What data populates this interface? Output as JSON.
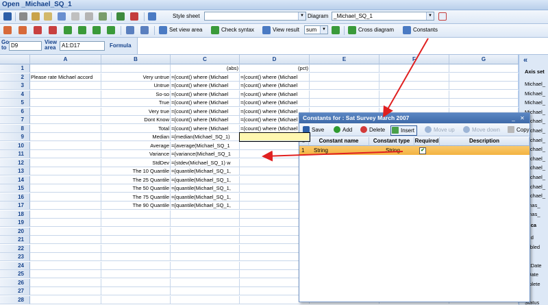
{
  "window": {
    "title": "Open _Michael_SQ_1"
  },
  "toolbar1": {
    "stylesheet_label": "Style sheet",
    "stylesheet_value": "",
    "diagram_label": "Diagram",
    "diagram_value": "_Michael_SQ_1"
  },
  "toolbar2": {
    "set_view_area": "Set view area",
    "check_syntax": "Check syntax",
    "view_result": "View result",
    "agg_value": "sum",
    "cross_diagram": "Cross diagram",
    "constants": "Constants"
  },
  "formula_bar": {
    "goto_label": "Go to",
    "goto_value": "D9",
    "view_area_label": "View area",
    "view_area_value": "A1:D17",
    "formula_label": "Formula"
  },
  "sheet": {
    "columns": [
      "A",
      "B",
      "C",
      "D",
      "E",
      "F",
      "G"
    ],
    "selected_cell": "D9",
    "rows": [
      {
        "n": "1",
        "a": "",
        "b": "",
        "c": "(abs)",
        "d": "(pct)"
      },
      {
        "n": "2",
        "a": "Please rate Michael accord",
        "b": "Very untrue",
        "c": "={count() where (Michael",
        "d": "={count() where (Michael"
      },
      {
        "n": "3",
        "a": "",
        "b": "Untrue",
        "c": "={count() where (Michael",
        "d": "={count() where (Michael"
      },
      {
        "n": "4",
        "a": "",
        "b": "So-so",
        "c": "={count() where (Michael",
        "d": "={count() where (Michael"
      },
      {
        "n": "5",
        "a": "",
        "b": "True",
        "c": "={count() where (Michael",
        "d": "={count() where (Michael"
      },
      {
        "n": "6",
        "a": "",
        "b": "Very true",
        "c": "={count() where (Michael",
        "d": "={count() where (Michael"
      },
      {
        "n": "7",
        "a": "",
        "b": "Dont Know",
        "c": "={count() where (Michael",
        "d": "={count() where (Michael"
      },
      {
        "n": "8",
        "a": "",
        "b": "Total",
        "c": "={count() where (Michael",
        "d": "={count() where (Michael"
      },
      {
        "n": "9",
        "a": "",
        "b": "Median",
        "c": "={median(Michael_SQ_1)",
        "d": ""
      },
      {
        "n": "10",
        "a": "",
        "b": "Average",
        "c": "={average(Michael_SQ_1",
        "d": ""
      },
      {
        "n": "11",
        "a": "",
        "b": "Variance",
        "c": "={variance(Michael_SQ_1",
        "d": ""
      },
      {
        "n": "12",
        "a": "",
        "b": "StdDev",
        "c": "={stdev(Michael_SQ_1) w",
        "d": ""
      },
      {
        "n": "13",
        "a": "",
        "b": "The 10 Quantile",
        "c": "={quantile(Michael_SQ_1,",
        "d": ""
      },
      {
        "n": "14",
        "a": "",
        "b": "The 25 Quantile",
        "c": "={quantile(Michael_SQ_1,",
        "d": ""
      },
      {
        "n": "15",
        "a": "",
        "b": "The 50 Quantile",
        "c": "={quantile(Michael_SQ_1,",
        "d": ""
      },
      {
        "n": "16",
        "a": "",
        "b": "The 75 Quantile",
        "c": "={quantile(Michael_SQ_1,",
        "d": ""
      },
      {
        "n": "17",
        "a": "",
        "b": "The 90 Quantile",
        "c": "={quantile(Michael_SQ_1,",
        "d": ""
      },
      {
        "n": "18",
        "a": "",
        "b": "",
        "c": "",
        "d": ""
      },
      {
        "n": "19",
        "a": "",
        "b": "",
        "c": "",
        "d": ""
      },
      {
        "n": "20",
        "a": "",
        "b": "",
        "c": "",
        "d": ""
      },
      {
        "n": "21",
        "a": "",
        "b": "",
        "c": "",
        "d": ""
      },
      {
        "n": "22",
        "a": "",
        "b": "",
        "c": "",
        "d": ""
      },
      {
        "n": "23",
        "a": "",
        "b": "",
        "c": "",
        "d": ""
      },
      {
        "n": "24",
        "a": "",
        "b": "",
        "c": "",
        "d": ""
      },
      {
        "n": "25",
        "a": "",
        "b": "",
        "c": "",
        "d": ""
      },
      {
        "n": "26",
        "a": "",
        "b": "",
        "c": "",
        "d": ""
      },
      {
        "n": "27",
        "a": "",
        "b": "",
        "c": "",
        "d": ""
      },
      {
        "n": "28",
        "a": "",
        "b": "",
        "c": "",
        "d": ""
      }
    ]
  },
  "right_panel": {
    "collapse_glyph": "«",
    "header1": "Axis set",
    "items1": [
      "Michael_",
      "Michael_",
      "Michael_",
      "Michael_",
      "Michael_",
      "Michael_",
      "Michael_",
      "Michael_",
      "Michael_",
      "Michael_",
      "Michael_",
      "Michael_",
      "Michael_",
      "omas_",
      "omas_"
    ],
    "header2": "ta ca",
    "items2": [
      "erId",
      "sabled",
      "",
      "artDate",
      "dDate",
      "mplete",
      "st",
      "Status"
    ]
  },
  "dialog": {
    "title": "Constants for : Sat Survey March 2007",
    "buttons": {
      "save": "Save",
      "add": "Add",
      "delete": "Delete",
      "insert": "Insert",
      "move_up": "Move up",
      "move_down": "Move down",
      "copy": "Copy"
    },
    "columns": [
      "#",
      "Constant name",
      "Constant type",
      "Required",
      "Description"
    ],
    "rows": [
      {
        "num": "1",
        "name": "String",
        "type": "String",
        "required": true,
        "description": ""
      }
    ],
    "checkmark": "✔"
  },
  "colors": {
    "annotation_arrow": "#e02020",
    "selected_row": "#f3b341",
    "dialog_title": "#4a78b6"
  }
}
